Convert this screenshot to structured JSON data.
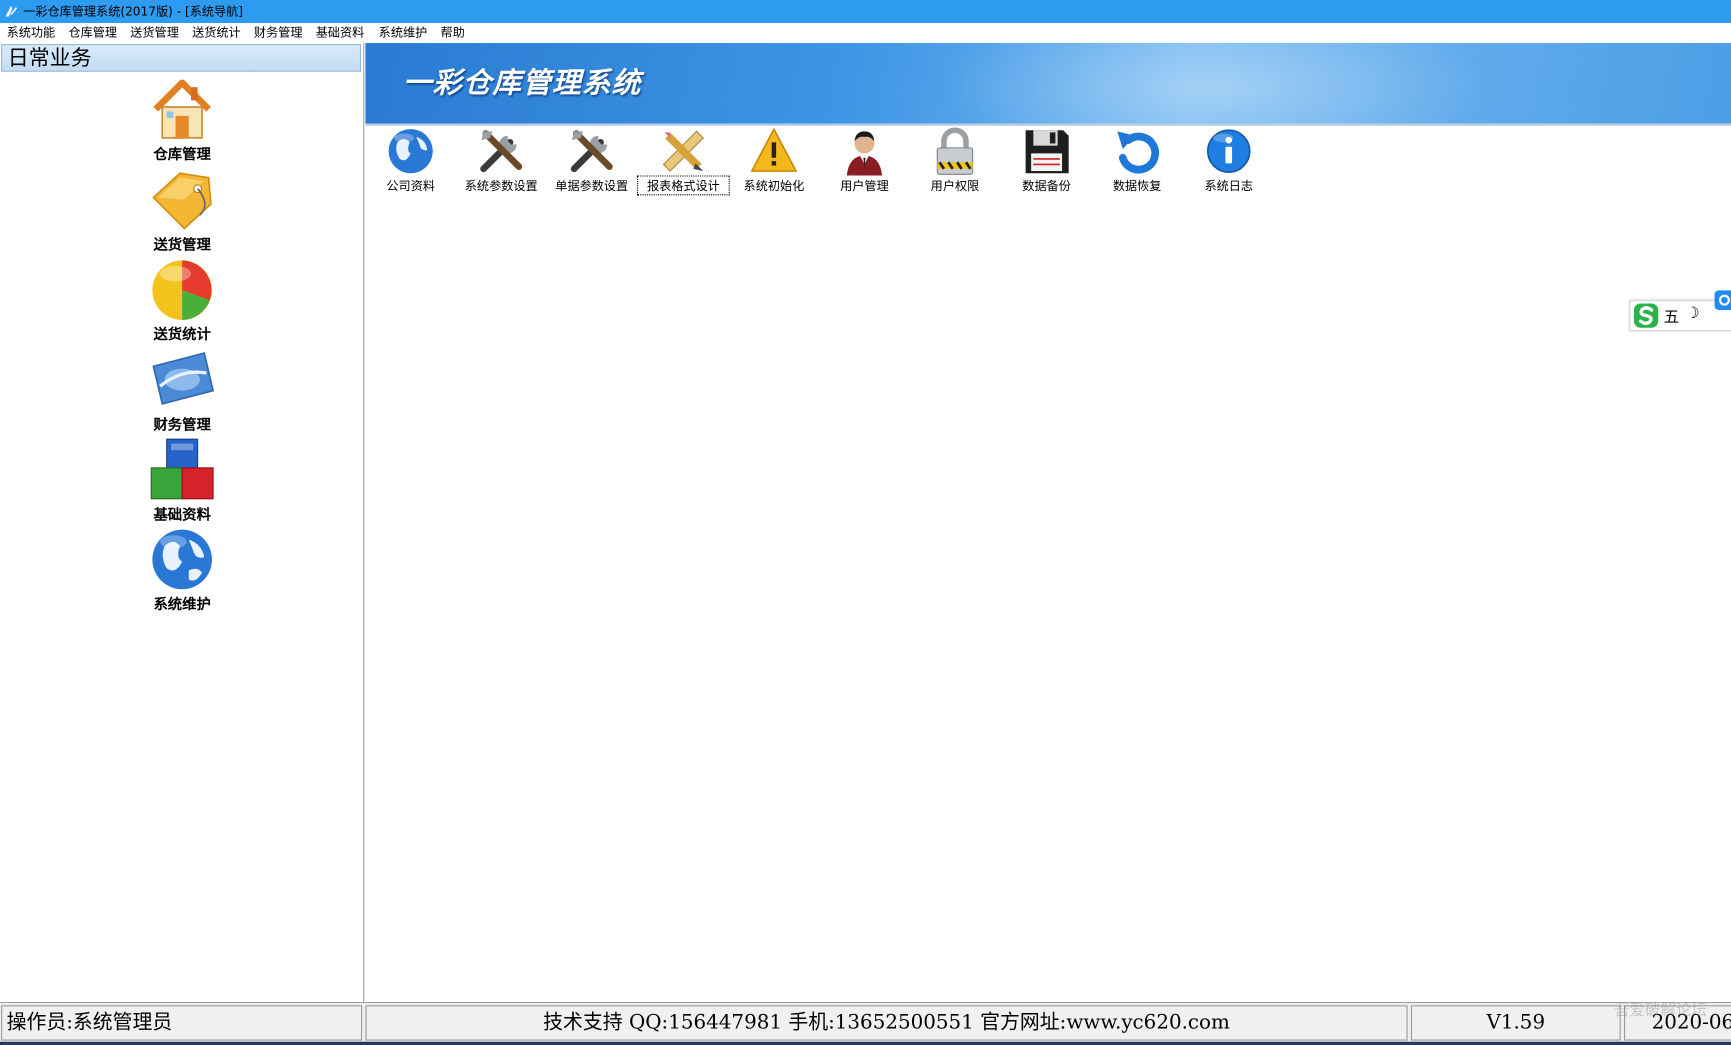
{
  "window": {
    "title": "一彩仓库管理系统(2017版) - [系统导航]"
  },
  "menu": [
    "系统功能",
    "仓库管理",
    "送货管理",
    "送货统计",
    "财务管理",
    "基础资料",
    "系统维护",
    "帮助"
  ],
  "sidebar": {
    "header": "日常业务",
    "items": [
      {
        "label": "仓库管理",
        "icon": "house-icon"
      },
      {
        "label": "送货管理",
        "icon": "tag-icon"
      },
      {
        "label": "送货统计",
        "icon": "pie-chart-icon"
      },
      {
        "label": "财务管理",
        "icon": "card-icon"
      },
      {
        "label": "基础资料",
        "icon": "blocks-icon"
      },
      {
        "label": "系统维护",
        "icon": "globe-icon"
      }
    ]
  },
  "banner": {
    "title": "一彩仓库管理系统"
  },
  "toolbar": [
    {
      "label": "公司资料",
      "icon": "globe-icon"
    },
    {
      "label": "系统参数设置",
      "icon": "tools-icon"
    },
    {
      "label": "单据参数设置",
      "icon": "tools-icon"
    },
    {
      "label": "报表格式设计",
      "icon": "ruler-pencil-icon"
    },
    {
      "label": "系统初始化",
      "icon": "warning-icon"
    },
    {
      "label": "用户管理",
      "icon": "user-icon"
    },
    {
      "label": "用户权限",
      "icon": "lock-icon"
    },
    {
      "label": "数据备份",
      "icon": "floppy-icon"
    },
    {
      "label": "数据恢复",
      "icon": "restore-icon"
    },
    {
      "label": "系统日志",
      "icon": "info-icon"
    }
  ],
  "ime": {
    "mode": "五"
  },
  "status": {
    "operator": "操作员:系统管理员",
    "support": "技术支持 QQ:156447981 手机:13652500551 官方网址:www.yc620.com",
    "version": "V1.59",
    "date": "2020-06"
  },
  "watermark": "吾爱破解论坛"
}
